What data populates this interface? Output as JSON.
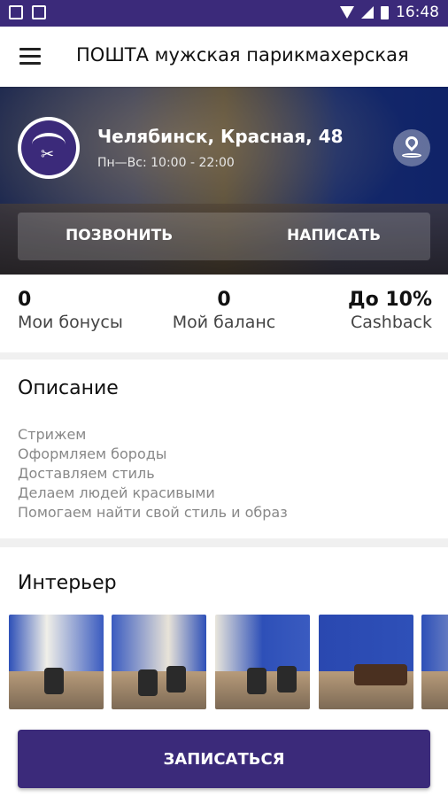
{
  "status_bar": {
    "time": "16:48"
  },
  "app_bar": {
    "title": "ПОШТА мужская парикмахерская"
  },
  "hero": {
    "address": "Челябинск, Красная, 48",
    "hours": "Пн—Вс: 10:00 - 22:00",
    "call_label": "ПОЗВОНИТЬ",
    "write_label": "НАПИСАТЬ"
  },
  "stats": [
    {
      "value": "0",
      "label": "Мои бонусы"
    },
    {
      "value": "0",
      "label": "Мой баланс"
    },
    {
      "value": "До 10%",
      "label": "Cashback"
    }
  ],
  "description": {
    "title": "Описание",
    "lines": [
      "Стрижем",
      "Оформляем бороды",
      "Доставляем стиль",
      "Делаем людей красивыми",
      "Помогаем найти свой стиль и образ"
    ]
  },
  "interior": {
    "title": "Интерьер",
    "photo_count": 5
  },
  "book_button": {
    "label": "ЗАПИСАТЬСЯ"
  },
  "colors": {
    "primary": "#3b2a7a",
    "divider": "#f0f0f0"
  }
}
